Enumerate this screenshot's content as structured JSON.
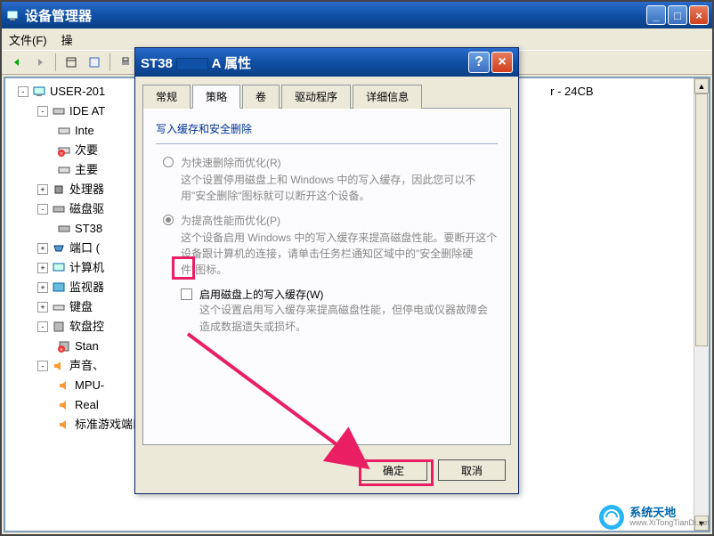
{
  "main_window": {
    "title": "设备管理器",
    "menu": {
      "file": "文件(F)",
      "action": "操"
    },
    "win_controls": {
      "min": "_",
      "max": "□",
      "close": "×"
    }
  },
  "tree": {
    "root": "USER-201",
    "nodes": [
      {
        "label": "IDE AT",
        "toggle": "-"
      },
      {
        "label": "Inte",
        "toggle": ""
      },
      {
        "label": "次要",
        "toggle": ""
      },
      {
        "label": "主要",
        "toggle": ""
      },
      {
        "label": "处理器",
        "toggle": "+"
      },
      {
        "label": "磁盘驱",
        "toggle": "-"
      },
      {
        "label": "ST38",
        "toggle": ""
      },
      {
        "label": "端口 (",
        "toggle": "+"
      },
      {
        "label": "计算机",
        "toggle": "+"
      },
      {
        "label": "监视器",
        "toggle": "+"
      },
      {
        "label": "键盘",
        "toggle": "+"
      },
      {
        "label": "软盘控",
        "toggle": "-"
      },
      {
        "label": "Stan",
        "toggle": ""
      },
      {
        "label": "声音、",
        "toggle": "-"
      },
      {
        "label": "MPU-",
        "toggle": ""
      },
      {
        "label": "Real",
        "toggle": ""
      },
      {
        "label": "标准游戏端口",
        "toggle": ""
      }
    ],
    "right_text": "r - 24CB"
  },
  "dialog": {
    "title_prefix": "ST38",
    "title_suffix": "A 属性",
    "help": "?",
    "close": "×",
    "tabs": {
      "general": "常规",
      "policy": "策略",
      "volumes": "卷",
      "driver": "驱动程序",
      "details": "详细信息"
    },
    "panel": {
      "group_title": "写入缓存和安全删除",
      "opt_fast": {
        "label": "为快速删除而优化(R)",
        "desc": "这个设置停用磁盘上和 Windows 中的写入缓存，因此您可以不用\"安全删除\"图标就可以断开这个设备。"
      },
      "opt_perf": {
        "label": "为提高性能而优化(P)",
        "desc": "这个设备启用 Windows 中的写入缓存来提高磁盘性能。要断开这个设备跟计算机的连接，请单击任务栏通知区域中的\"安全删除硬件\"图标。"
      },
      "check": {
        "label": "启用磁盘上的写入缓存(W)",
        "desc": "这个设置启用写入缓存来提高磁盘性能，但停电或仪器故障会造成数据遗失或损坏。"
      }
    },
    "buttons": {
      "ok": "确定",
      "cancel": "取消"
    }
  },
  "watermark": {
    "cn": "系统天地",
    "url": "www.XiTongTianDi.net"
  }
}
